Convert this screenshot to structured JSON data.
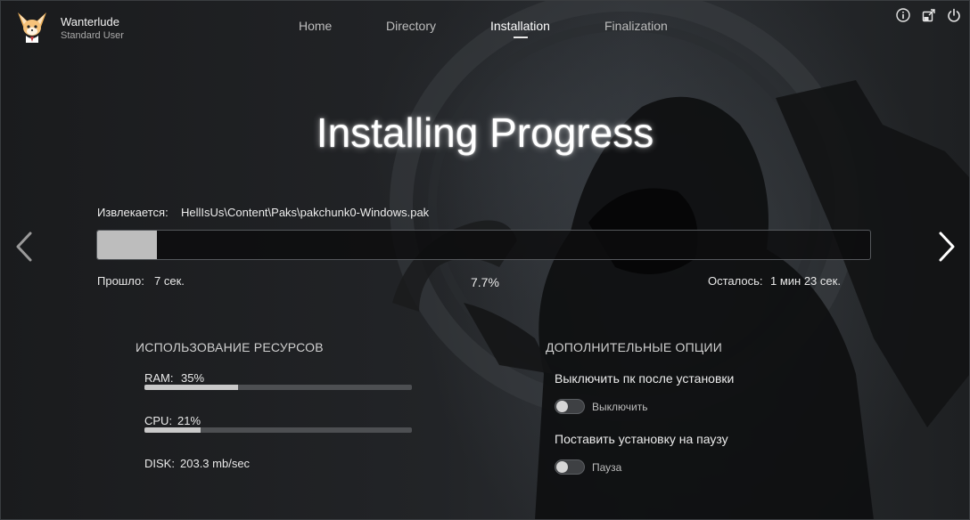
{
  "user": {
    "name": "Wanterlude",
    "role": "Standard User"
  },
  "nav": {
    "items": [
      {
        "label": "Home"
      },
      {
        "label": "Directory"
      },
      {
        "label": "Installation"
      },
      {
        "label": "Finalization"
      }
    ],
    "active": "Installation"
  },
  "top_icons": [
    "info-icon",
    "minimize-icon",
    "power-icon"
  ],
  "title": "Installing Progress",
  "extract": {
    "label": "Извлекается:",
    "path": "HellIsUs\\Content\\Paks\\pakchunk0-Windows.pak"
  },
  "progress": {
    "value": 0.077,
    "percent_text": "7.7%",
    "elapsed_label": "Прошло:",
    "elapsed_value": "7 сек.",
    "remaining_label": "Осталось:",
    "remaining_value": "1 мин 23 сек."
  },
  "resources": {
    "heading": "ИСПОЛЬЗОВАНИЕ РЕСУРСОВ",
    "ram": {
      "label": "RAM:",
      "value": "35%",
      "level": 0.35
    },
    "cpu": {
      "label": "CPU:",
      "value": "21%",
      "level": 0.21
    },
    "disk": {
      "label": "DISK:",
      "value": "203.3 mb/sec"
    }
  },
  "options": {
    "heading": "ДОПОЛНИТЕЛЬНЫЕ ОПЦИИ",
    "shutdown": {
      "label": "Выключить пк после установки",
      "toggle_text": "Выключить",
      "enabled": false
    },
    "pause": {
      "label": "Поставить установку на паузу",
      "toggle_text": "Пауза",
      "enabled": false
    }
  },
  "colors": {
    "accent": "#bdbdbd",
    "background": "#151618",
    "text": "#e9e9e9"
  }
}
